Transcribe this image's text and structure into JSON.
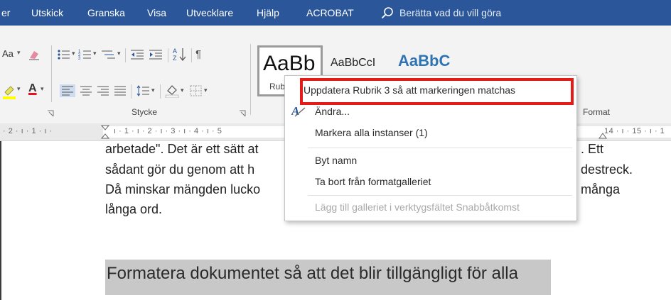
{
  "tabs": [
    "er",
    "Utskick",
    "Granska",
    "Visa",
    "Utvecklare",
    "Hjälp",
    "ACROBAT"
  ],
  "search": {
    "text": "Berätta vad du vill göra"
  },
  "ribbon": {
    "font_size_btn": "Aa",
    "stycke_label": "Stycke",
    "format_label": "Format",
    "styles": {
      "preview1": "AaBb",
      "preview1_name": "Rub",
      "preview2": "AaBbCcI",
      "preview3": "AaBbC"
    }
  },
  "ruler": {
    "left": "· 2 · ı · 1 · ı ·",
    "middle": "ı · 1 · ı · 2 · ı · 3 · ı · 4 · ı · 5",
    "right": "14 · ı · 15 · ı · 1"
  },
  "doc": {
    "line1_left": "arbetade\". Det är ett sätt at",
    "line1_right": ". Ett",
    "line2_left": "sådant gör du genom att h",
    "line2_right": "destreck.",
    "line3_left": "Då minskar mängden lucko",
    "line3_right": "många",
    "line4": "långa ord.",
    "heading": "Formatera dokumentet så att det blir tillgängligt för alla"
  },
  "context_menu": {
    "update": "Uppdatera Rubrik 3 så att markeringen matchas",
    "modify": "Ändra...",
    "select_all": "Markera alla instanser (1)",
    "rename": "Byt namn",
    "remove": "Ta bort från formatgalleriet",
    "add_qat": "Lägg till galleriet i verktygsfältet Snabbåtkomst"
  },
  "colors": {
    "ribbon_blue": "#2b579a",
    "highlight_red": "#e41b17",
    "font_red": "#e81123",
    "heading_band": "#c8c8c8"
  }
}
